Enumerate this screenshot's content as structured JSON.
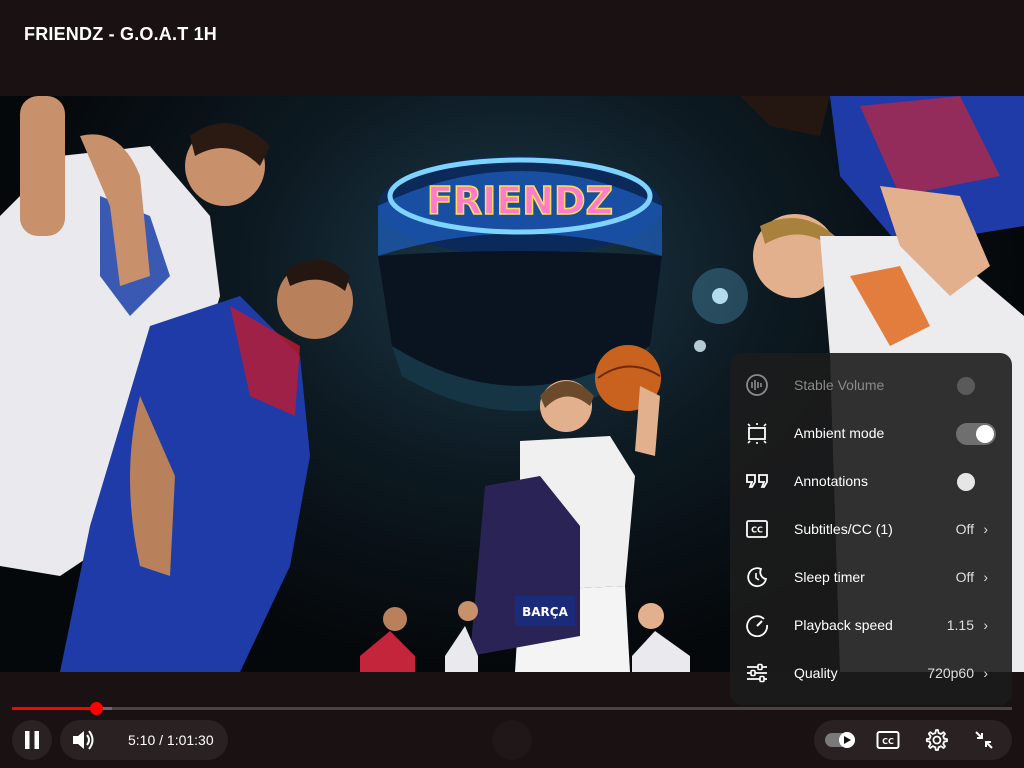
{
  "video": {
    "title": "FRIENDZ - G.O.A.T 1H",
    "overlay_text": "FRIENDZ"
  },
  "player": {
    "current_time": "5:10",
    "separator": " / ",
    "duration": "1:01:30",
    "progress_fraction": 0.0839,
    "buffered_fraction": 0.1
  },
  "settings_menu": {
    "items": [
      {
        "label": "Stable Volume",
        "icon": "stable-volume-icon",
        "type": "toggle",
        "on": false,
        "disabled": true
      },
      {
        "label": "Ambient mode",
        "icon": "ambient-mode-icon",
        "type": "toggle",
        "on": true,
        "disabled": false
      },
      {
        "label": "Annotations",
        "icon": "annotations-icon",
        "type": "toggle",
        "on": false,
        "disabled": false
      },
      {
        "label": "Subtitles/CC (1)",
        "icon": "subtitles-icon",
        "type": "value",
        "value": "Off"
      },
      {
        "label": "Sleep timer",
        "icon": "sleep-timer-icon",
        "type": "value",
        "value": "Off"
      },
      {
        "label": "Playback speed",
        "icon": "playback-speed-icon",
        "type": "value",
        "value": "1.15"
      },
      {
        "label": "Quality",
        "icon": "quality-icon",
        "type": "value",
        "value": "720p60"
      }
    ]
  },
  "colors": {
    "progress": "#ff0000",
    "background": "#1a1112",
    "menu_bg": "#1c1c1c"
  }
}
